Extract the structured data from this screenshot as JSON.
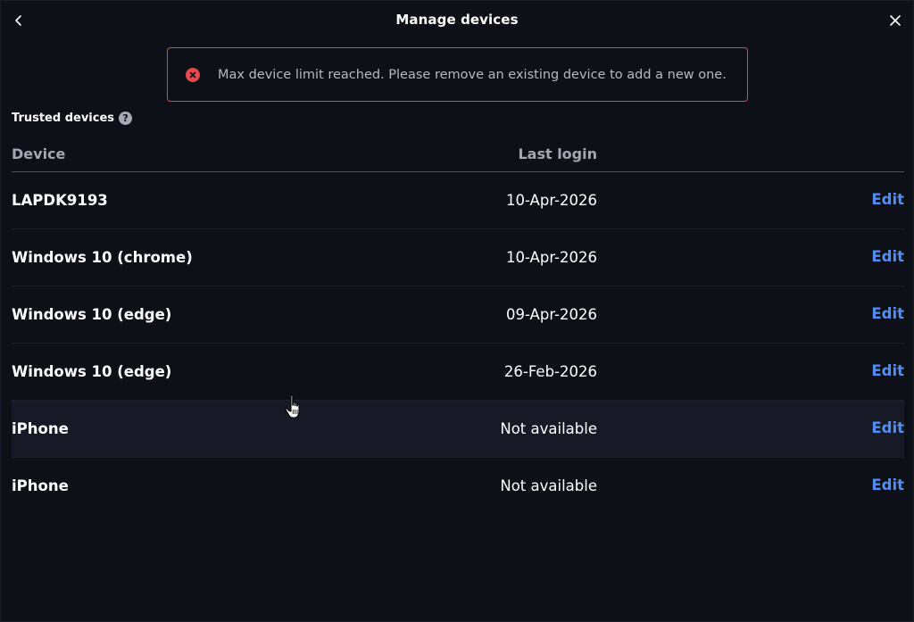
{
  "dialog": {
    "title": "Manage devices"
  },
  "alert": {
    "message": "Max device limit reached. Please remove an existing device to add a new one.",
    "color": "#e5484d"
  },
  "section": {
    "label": "Trusted devices",
    "help_glyph": "?"
  },
  "table": {
    "columns": {
      "device": "Device",
      "last_login": "Last login"
    },
    "rows": [
      {
        "device": "LAPDK9193",
        "last_login": "10-Apr-2026",
        "action": "Edit"
      },
      {
        "device": "Windows 10 (chrome)",
        "last_login": "10-Apr-2026",
        "action": "Edit"
      },
      {
        "device": "Windows 10 (edge)",
        "last_login": "09-Apr-2026",
        "action": "Edit"
      },
      {
        "device": "Windows 10 (edge)",
        "last_login": "26-Feb-2026",
        "action": "Edit"
      },
      {
        "device": "iPhone",
        "last_login": "Not available",
        "action": "Edit"
      },
      {
        "device": "iPhone",
        "last_login": "Not available",
        "action": "Edit"
      }
    ]
  },
  "icons": {
    "back": "chevron-left-icon",
    "close": "close-icon",
    "error": "error-circle-icon",
    "help": "help-circle-icon",
    "cursor": "hand-pointer-icon"
  },
  "colors": {
    "background": "#0e1018",
    "accent": "#4f8ef7",
    "error": "#e5484d",
    "hover_row": "#171a26"
  }
}
